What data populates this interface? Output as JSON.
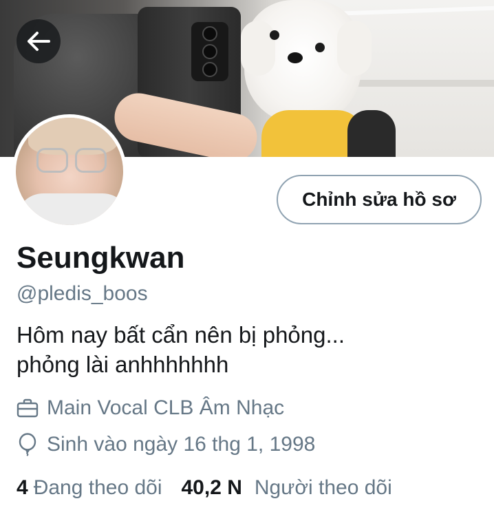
{
  "profile": {
    "name": "Seungkwan",
    "handle": "@pledis_boos",
    "bio_lines": [
      "Hôm nay bất cẩn nên bị phỏng...",
      "phỏng lài anhhhhhhh"
    ],
    "job": "Main Vocal CLB Âm Nhạc",
    "birthday": "Sinh vào ngày 16 thg 1, 1998"
  },
  "actions": {
    "edit_profile_label": "Chỉnh sửa hồ sơ"
  },
  "stats": {
    "following_count": "4",
    "following_label": "Đang theo dõi",
    "followers_count": "40,2 N",
    "followers_label": "Người theo dõi"
  },
  "icons": {
    "back": "arrow-left-icon",
    "job": "briefcase-icon",
    "birthday": "balloon-icon"
  },
  "colors": {
    "text_primary": "#14171a",
    "text_secondary": "#657786",
    "button_border": "#8fa2b1",
    "back_button_bg": "#14171a"
  }
}
